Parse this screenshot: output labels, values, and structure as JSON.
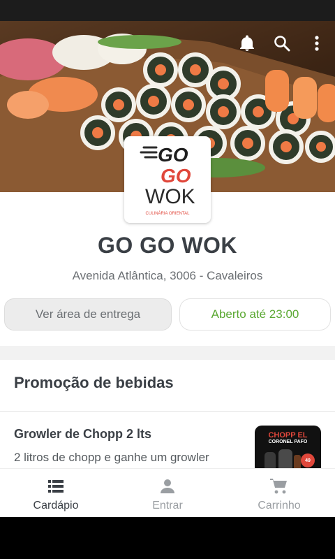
{
  "store": {
    "name": "GO GO WOK",
    "address": "Avenida Atlântica, 3006 - Cavaleiros",
    "logo_lines": [
      "GO",
      "GO",
      "WOK"
    ],
    "logo_tagline": "CULINÁRIA ORIENTAL"
  },
  "actions": {
    "delivery_area": "Ver área de entrega",
    "open_status": "Aberto até 23:00"
  },
  "top_icons": [
    "bell-icon",
    "search-icon",
    "more-vert-icon"
  ],
  "section": {
    "title": "Promoção de bebidas",
    "items": [
      {
        "name": "Growler de Chopp 2 lts",
        "description": "2 litros de chopp e ganhe um growler",
        "thumb_text": "CHOPP EL",
        "thumb_subtext": "CORONEL PAFO",
        "thumb_price": "49"
      }
    ]
  },
  "bottom_nav": {
    "items": [
      {
        "label": "Cardápio",
        "icon": "menu-list-icon",
        "active": true
      },
      {
        "label": "Entrar",
        "icon": "user-icon",
        "active": false
      },
      {
        "label": "Carrinho",
        "icon": "cart-icon",
        "active": false
      }
    ]
  },
  "colors": {
    "open_green": "#5aa832",
    "logo_red": "#e0473b",
    "text_dark": "#3a3f45"
  }
}
